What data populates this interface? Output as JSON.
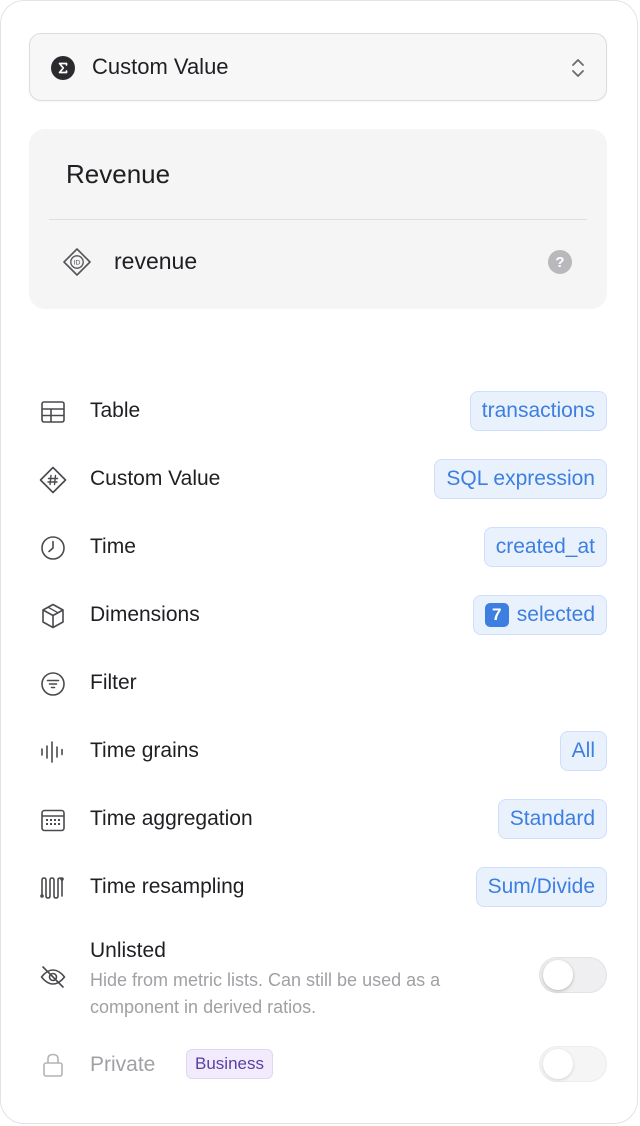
{
  "type_selector": {
    "label": "Custom Value",
    "icon": "sigma-icon"
  },
  "metric": {
    "name": "Revenue",
    "id": "revenue"
  },
  "settings": [
    {
      "key": "table",
      "label": "Table",
      "icon": "table-icon",
      "value": "transactions"
    },
    {
      "key": "custom-value",
      "label": "Custom Value",
      "icon": "hash-diamond-icon",
      "value": "SQL expression"
    },
    {
      "key": "time",
      "label": "Time",
      "icon": "clock-icon",
      "value": "created_at"
    },
    {
      "key": "dimensions",
      "label": "Dimensions",
      "icon": "cube-icon",
      "count": "7",
      "value": "selected"
    },
    {
      "key": "filter",
      "label": "Filter",
      "icon": "filter-icon",
      "value": ""
    },
    {
      "key": "time-grains",
      "label": "Time grains",
      "icon": "bars-icon",
      "value": "All"
    },
    {
      "key": "time-aggregation",
      "label": "Time aggregation",
      "icon": "calendar-icon",
      "value": "Standard"
    },
    {
      "key": "time-resampling",
      "label": "Time resampling",
      "icon": "resample-icon",
      "value": "Sum/Divide"
    }
  ],
  "unlisted": {
    "label": "Unlisted",
    "description": "Hide from metric lists. Can still be used as a component in derived ratios.",
    "enabled": false
  },
  "private": {
    "label": "Private",
    "badge": "Business",
    "enabled": false
  },
  "colors": {
    "accent": "#3d7fe0",
    "pill_bg": "#e9f1fd",
    "badge_purple": "#5a3ea6"
  }
}
